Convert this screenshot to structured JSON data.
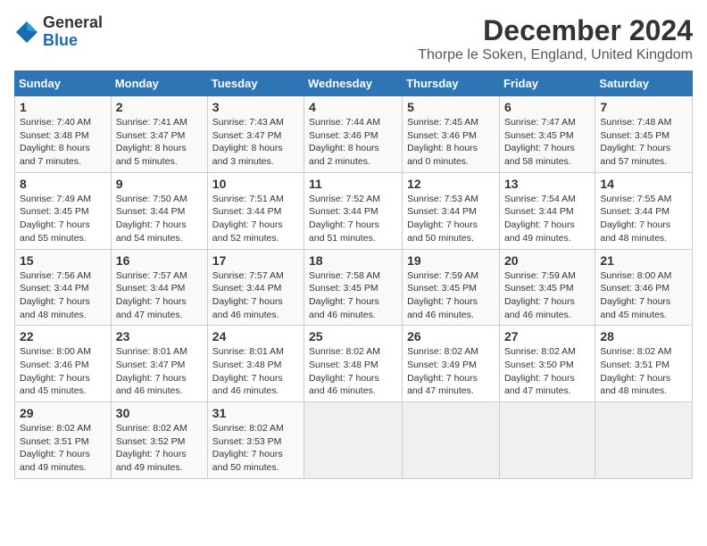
{
  "logo": {
    "general": "General",
    "blue": "Blue"
  },
  "title": "December 2024",
  "subtitle": "Thorpe le Soken, England, United Kingdom",
  "days_of_week": [
    "Sunday",
    "Monday",
    "Tuesday",
    "Wednesday",
    "Thursday",
    "Friday",
    "Saturday"
  ],
  "weeks": [
    [
      {
        "day": "1",
        "sunrise": "Sunrise: 7:40 AM",
        "sunset": "Sunset: 3:48 PM",
        "daylight": "Daylight: 8 hours and 7 minutes."
      },
      {
        "day": "2",
        "sunrise": "Sunrise: 7:41 AM",
        "sunset": "Sunset: 3:47 PM",
        "daylight": "Daylight: 8 hours and 5 minutes."
      },
      {
        "day": "3",
        "sunrise": "Sunrise: 7:43 AM",
        "sunset": "Sunset: 3:47 PM",
        "daylight": "Daylight: 8 hours and 3 minutes."
      },
      {
        "day": "4",
        "sunrise": "Sunrise: 7:44 AM",
        "sunset": "Sunset: 3:46 PM",
        "daylight": "Daylight: 8 hours and 2 minutes."
      },
      {
        "day": "5",
        "sunrise": "Sunrise: 7:45 AM",
        "sunset": "Sunset: 3:46 PM",
        "daylight": "Daylight: 8 hours and 0 minutes."
      },
      {
        "day": "6",
        "sunrise": "Sunrise: 7:47 AM",
        "sunset": "Sunset: 3:45 PM",
        "daylight": "Daylight: 7 hours and 58 minutes."
      },
      {
        "day": "7",
        "sunrise": "Sunrise: 7:48 AM",
        "sunset": "Sunset: 3:45 PM",
        "daylight": "Daylight: 7 hours and 57 minutes."
      }
    ],
    [
      {
        "day": "8",
        "sunrise": "Sunrise: 7:49 AM",
        "sunset": "Sunset: 3:45 PM",
        "daylight": "Daylight: 7 hours and 55 minutes."
      },
      {
        "day": "9",
        "sunrise": "Sunrise: 7:50 AM",
        "sunset": "Sunset: 3:44 PM",
        "daylight": "Daylight: 7 hours and 54 minutes."
      },
      {
        "day": "10",
        "sunrise": "Sunrise: 7:51 AM",
        "sunset": "Sunset: 3:44 PM",
        "daylight": "Daylight: 7 hours and 52 minutes."
      },
      {
        "day": "11",
        "sunrise": "Sunrise: 7:52 AM",
        "sunset": "Sunset: 3:44 PM",
        "daylight": "Daylight: 7 hours and 51 minutes."
      },
      {
        "day": "12",
        "sunrise": "Sunrise: 7:53 AM",
        "sunset": "Sunset: 3:44 PM",
        "daylight": "Daylight: 7 hours and 50 minutes."
      },
      {
        "day": "13",
        "sunrise": "Sunrise: 7:54 AM",
        "sunset": "Sunset: 3:44 PM",
        "daylight": "Daylight: 7 hours and 49 minutes."
      },
      {
        "day": "14",
        "sunrise": "Sunrise: 7:55 AM",
        "sunset": "Sunset: 3:44 PM",
        "daylight": "Daylight: 7 hours and 48 minutes."
      }
    ],
    [
      {
        "day": "15",
        "sunrise": "Sunrise: 7:56 AM",
        "sunset": "Sunset: 3:44 PM",
        "daylight": "Daylight: 7 hours and 48 minutes."
      },
      {
        "day": "16",
        "sunrise": "Sunrise: 7:57 AM",
        "sunset": "Sunset: 3:44 PM",
        "daylight": "Daylight: 7 hours and 47 minutes."
      },
      {
        "day": "17",
        "sunrise": "Sunrise: 7:57 AM",
        "sunset": "Sunset: 3:44 PM",
        "daylight": "Daylight: 7 hours and 46 minutes."
      },
      {
        "day": "18",
        "sunrise": "Sunrise: 7:58 AM",
        "sunset": "Sunset: 3:45 PM",
        "daylight": "Daylight: 7 hours and 46 minutes."
      },
      {
        "day": "19",
        "sunrise": "Sunrise: 7:59 AM",
        "sunset": "Sunset: 3:45 PM",
        "daylight": "Daylight: 7 hours and 46 minutes."
      },
      {
        "day": "20",
        "sunrise": "Sunrise: 7:59 AM",
        "sunset": "Sunset: 3:45 PM",
        "daylight": "Daylight: 7 hours and 46 minutes."
      },
      {
        "day": "21",
        "sunrise": "Sunrise: 8:00 AM",
        "sunset": "Sunset: 3:46 PM",
        "daylight": "Daylight: 7 hours and 45 minutes."
      }
    ],
    [
      {
        "day": "22",
        "sunrise": "Sunrise: 8:00 AM",
        "sunset": "Sunset: 3:46 PM",
        "daylight": "Daylight: 7 hours and 45 minutes."
      },
      {
        "day": "23",
        "sunrise": "Sunrise: 8:01 AM",
        "sunset": "Sunset: 3:47 PM",
        "daylight": "Daylight: 7 hours and 46 minutes."
      },
      {
        "day": "24",
        "sunrise": "Sunrise: 8:01 AM",
        "sunset": "Sunset: 3:48 PM",
        "daylight": "Daylight: 7 hours and 46 minutes."
      },
      {
        "day": "25",
        "sunrise": "Sunrise: 8:02 AM",
        "sunset": "Sunset: 3:48 PM",
        "daylight": "Daylight: 7 hours and 46 minutes."
      },
      {
        "day": "26",
        "sunrise": "Sunrise: 8:02 AM",
        "sunset": "Sunset: 3:49 PM",
        "daylight": "Daylight: 7 hours and 47 minutes."
      },
      {
        "day": "27",
        "sunrise": "Sunrise: 8:02 AM",
        "sunset": "Sunset: 3:50 PM",
        "daylight": "Daylight: 7 hours and 47 minutes."
      },
      {
        "day": "28",
        "sunrise": "Sunrise: 8:02 AM",
        "sunset": "Sunset: 3:51 PM",
        "daylight": "Daylight: 7 hours and 48 minutes."
      }
    ],
    [
      {
        "day": "29",
        "sunrise": "Sunrise: 8:02 AM",
        "sunset": "Sunset: 3:51 PM",
        "daylight": "Daylight: 7 hours and 49 minutes."
      },
      {
        "day": "30",
        "sunrise": "Sunrise: 8:02 AM",
        "sunset": "Sunset: 3:52 PM",
        "daylight": "Daylight: 7 hours and 49 minutes."
      },
      {
        "day": "31",
        "sunrise": "Sunrise: 8:02 AM",
        "sunset": "Sunset: 3:53 PM",
        "daylight": "Daylight: 7 hours and 50 minutes."
      },
      null,
      null,
      null,
      null
    ]
  ]
}
